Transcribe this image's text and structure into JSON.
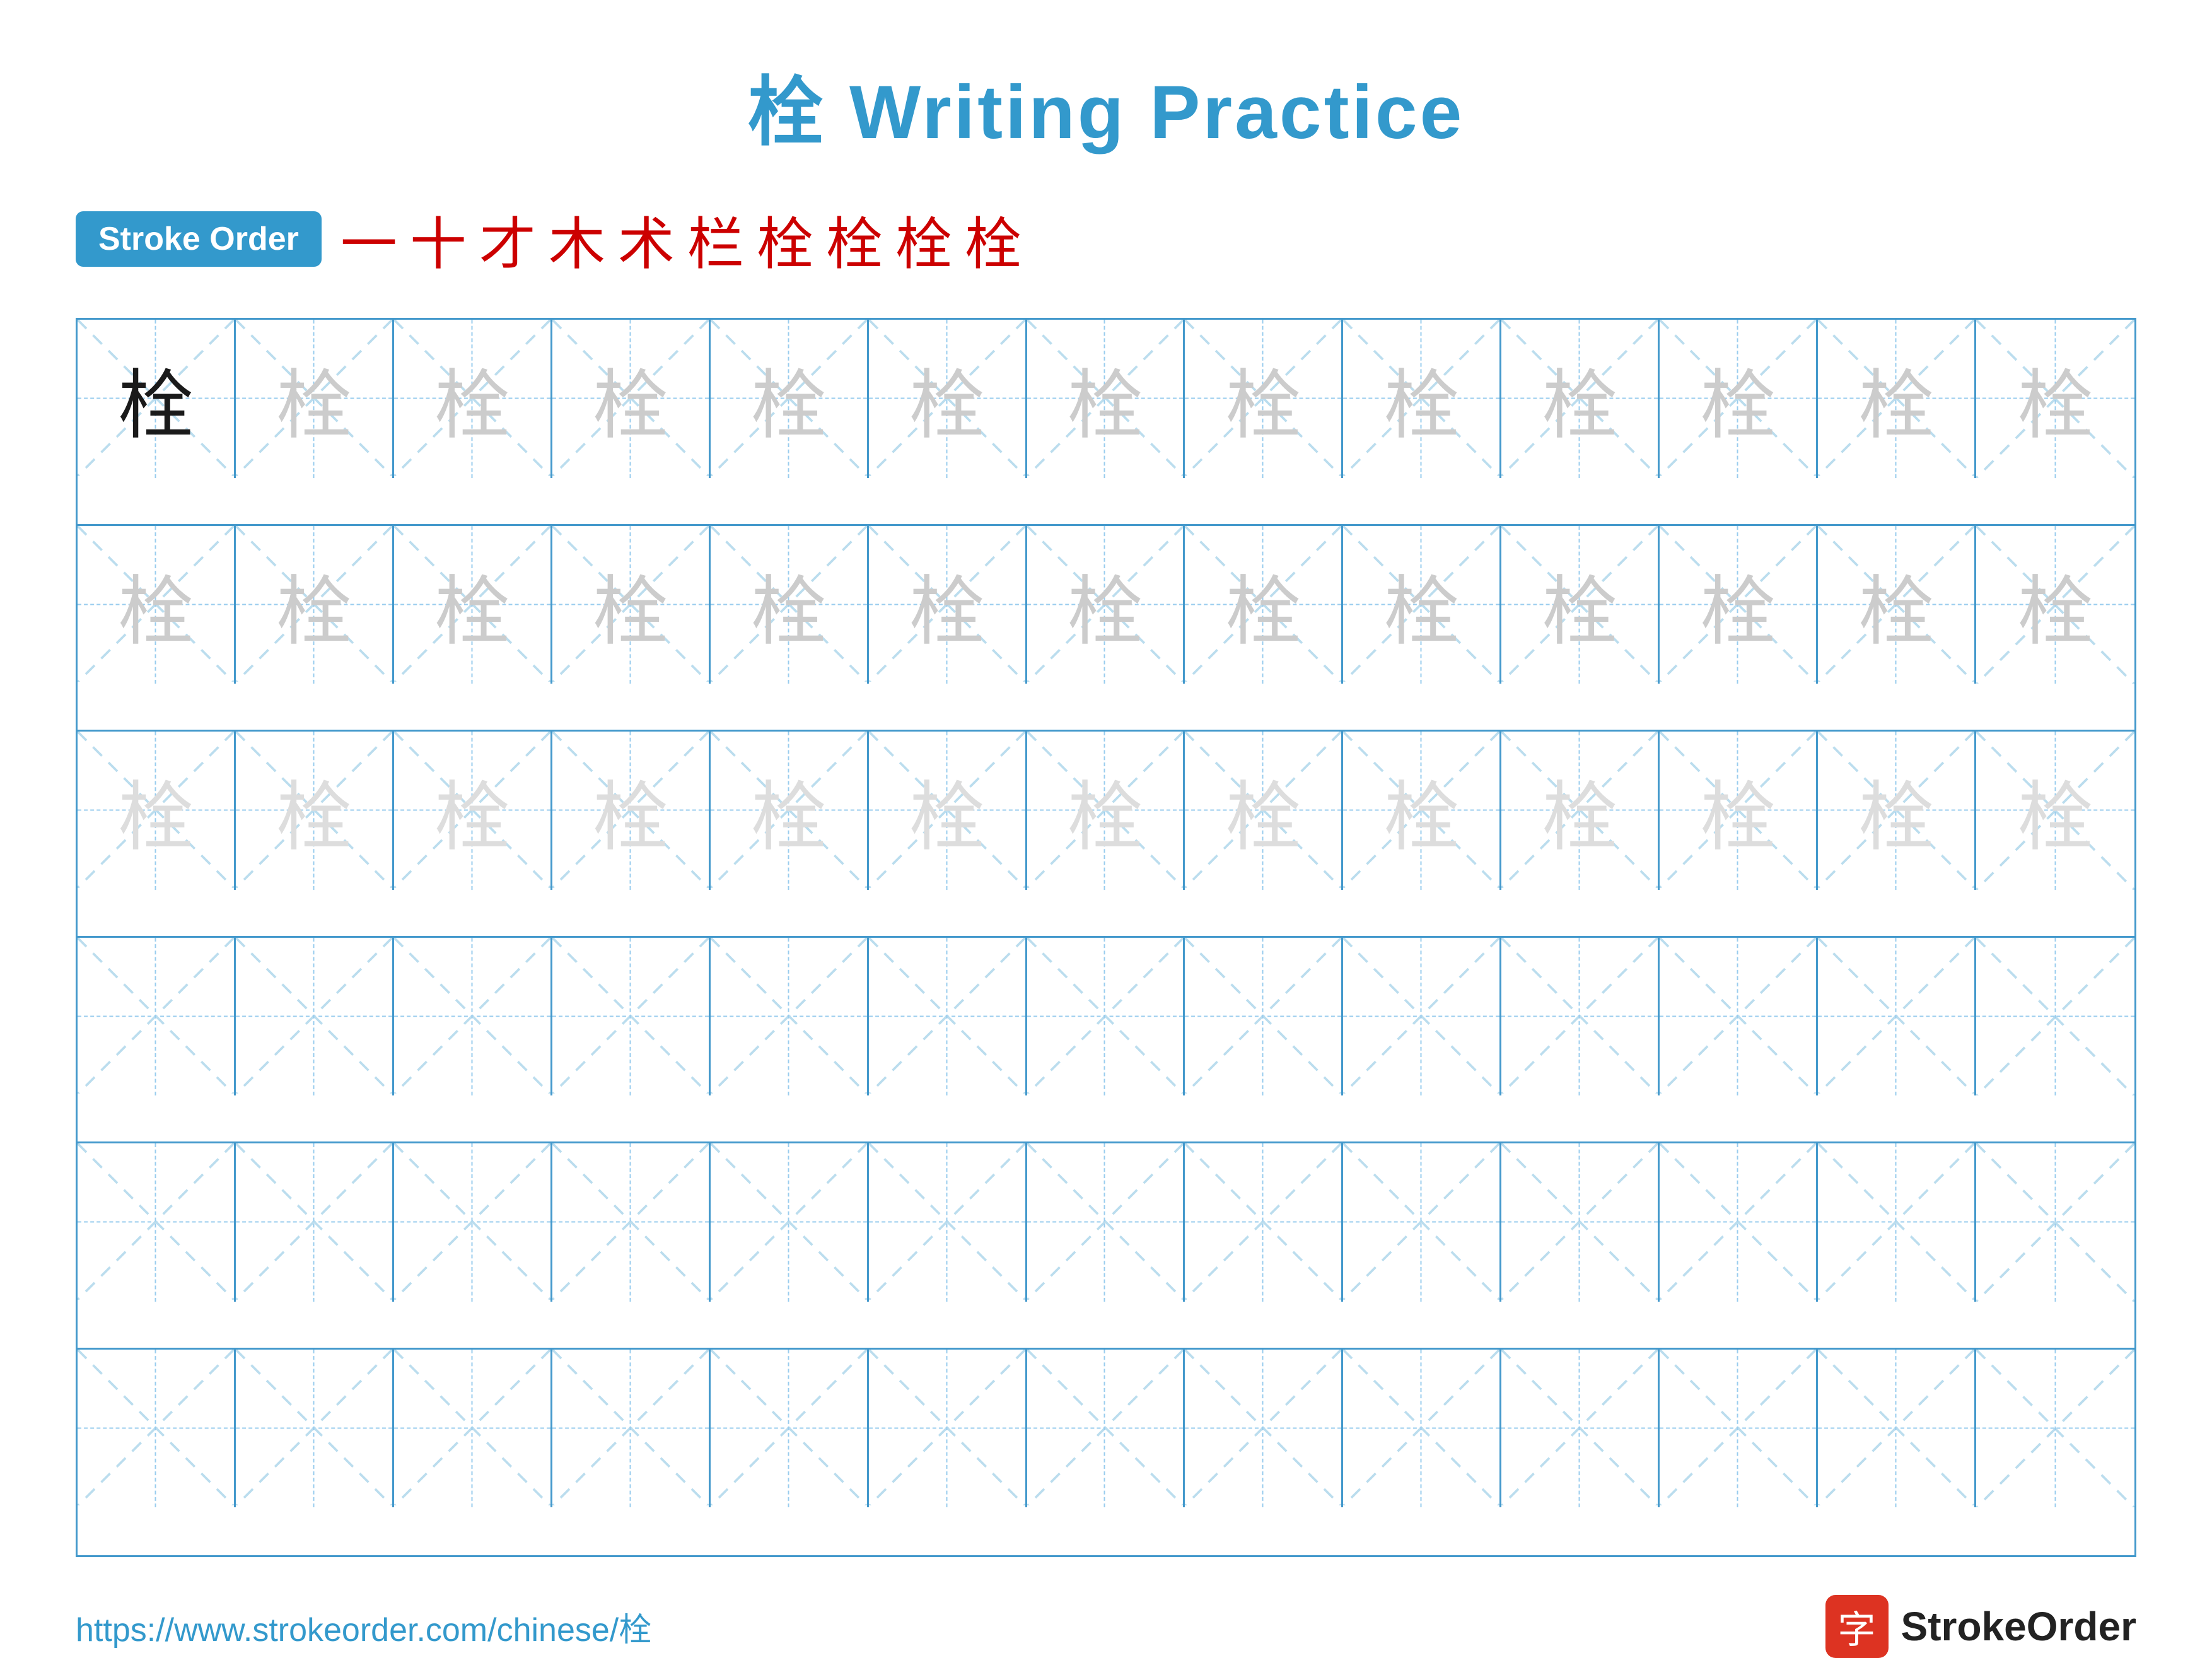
{
  "page": {
    "title_chinese": "栓",
    "title_text": " Writing Practice",
    "stroke_order_label": "Stroke Order",
    "stroke_sequence": [
      "一",
      "十",
      "才",
      "木",
      "术",
      "栏",
      "栓",
      "栓",
      "栓",
      "栓"
    ],
    "character": "栓",
    "url": "https://www.strokeorder.com/chinese/栓",
    "logo_char": "字",
    "logo_name": "StrokeOrder",
    "rows": [
      {
        "type": "dark_then_light",
        "first_dark": true,
        "count": 13
      },
      {
        "type": "light",
        "count": 13
      },
      {
        "type": "lighter",
        "count": 13
      },
      {
        "type": "empty",
        "count": 13
      },
      {
        "type": "empty",
        "count": 13
      },
      {
        "type": "empty",
        "count": 13
      }
    ]
  }
}
